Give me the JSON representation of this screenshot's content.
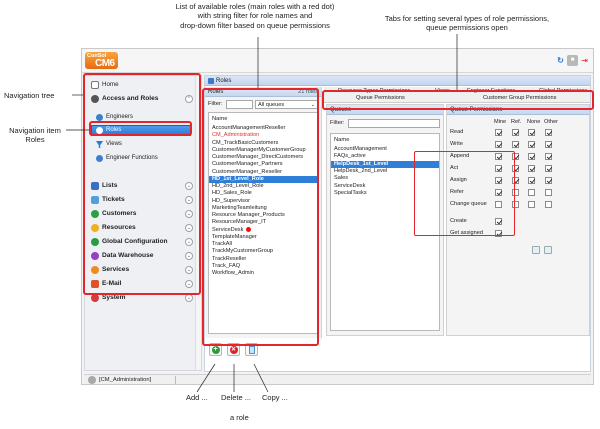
{
  "annotations": {
    "roles_list": [
      "List of available roles (main roles with a red dot)",
      "with string filter for role names and",
      "drop-down filter based on queue permissions"
    ],
    "tabs": [
      "Tabs for setting several types of role permissions,",
      "queue permissions open"
    ],
    "nav_tree": "Navigation tree",
    "nav_item": [
      "Navigation item",
      "Roles"
    ],
    "add": "Add ...",
    "delete": "Delete ...",
    "copy": "Copy ...",
    "a_role": "a role"
  },
  "app": {
    "logo_top": "ConSol",
    "logo_main": "CM6"
  },
  "sidebar": {
    "home": "Home",
    "access_and_roles": "Access and Roles",
    "sub_items": [
      "Engineers",
      "Roles",
      "Views",
      "Engineer Functions"
    ],
    "groups": [
      "Lists",
      "Tickets",
      "Customers",
      "Resources",
      "Global Configuration",
      "Data Warehouse",
      "Services",
      "E-Mail",
      "System"
    ]
  },
  "status": {
    "user": "[CM_Administration]"
  },
  "main": {
    "title": "Roles"
  },
  "roles_panel": {
    "title": "Roles",
    "count": "21 roles",
    "filter_label": "Filter:",
    "dropdown_value": "All queues",
    "list_header": "Name",
    "items": [
      {
        "name": "AccountManagementReseller",
        "style": ""
      },
      {
        "name": "CM_Administration",
        "style": "red"
      },
      {
        "name": "CM_TrackBasicCustomers",
        "style": ""
      },
      {
        "name": "CustomerManagerMyCustomerGroup",
        "style": ""
      },
      {
        "name": "CustomerManager_DirectCustomers",
        "style": ""
      },
      {
        "name": "CustomerManager_Partners",
        "style": ""
      },
      {
        "name": "CustomerManager_Reseller",
        "style": ""
      },
      {
        "name": "HD_1st_Level_Role",
        "style": "sel"
      },
      {
        "name": "HD_2nd_Level_Role",
        "style": ""
      },
      {
        "name": "HD_Sales_Role",
        "style": ""
      },
      {
        "name": "HD_Supervisor",
        "style": ""
      },
      {
        "name": "MarketingTeamleitung",
        "style": ""
      },
      {
        "name": "Resource Manager_Products",
        "style": ""
      },
      {
        "name": "ResourceManager_IT",
        "style": ""
      },
      {
        "name": "ServiceDesk",
        "style": "dot"
      },
      {
        "name": "TemplateManager",
        "style": ""
      },
      {
        "name": "TrackAll",
        "style": ""
      },
      {
        "name": "TrackMyCustomerGroup",
        "style": ""
      },
      {
        "name": "TrackReseller",
        "style": ""
      },
      {
        "name": "Track_FAQ",
        "style": ""
      },
      {
        "name": "Workflow_Admin",
        "style": ""
      }
    ]
  },
  "tabs": {
    "row1": [
      "Resource Types Permissions",
      "Views",
      "Engineer Functions",
      "Global Permissions"
    ],
    "row2": [
      "Queue Permissions",
      "Customer Group Permissions"
    ]
  },
  "queues_panel": {
    "title": "Queues",
    "filter_label": "Filter:",
    "list_header": "Name",
    "items": [
      {
        "name": "AccountManagement",
        "style": ""
      },
      {
        "name": "FAQs_active",
        "style": ""
      },
      {
        "name": "HelpDesk_1st_Level",
        "style": "sel"
      },
      {
        "name": "HelpDesk_2nd_Level",
        "style": ""
      },
      {
        "name": "Sales",
        "style": ""
      },
      {
        "name": "ServiceDesk",
        "style": ""
      },
      {
        "name": "SpecialTasks",
        "style": ""
      }
    ]
  },
  "queue_permissions": {
    "title": "Queue Permissions",
    "columns": [
      "Mine",
      "Ref.",
      "None",
      "Other"
    ],
    "rows": [
      {
        "label": "Read",
        "checks": [
          true,
          true,
          true,
          true
        ]
      },
      {
        "label": "Write",
        "checks": [
          true,
          true,
          true,
          true
        ]
      },
      {
        "label": "Append",
        "checks": [
          true,
          true,
          true,
          true
        ]
      },
      {
        "label": "Act",
        "checks": [
          true,
          true,
          true,
          true
        ]
      },
      {
        "label": "Assign",
        "checks": [
          true,
          true,
          true,
          true
        ]
      },
      {
        "label": "Refer",
        "checks": [
          true,
          false,
          false,
          false
        ]
      },
      {
        "label": "Change queue",
        "checks": [
          false,
          false,
          false,
          false
        ]
      }
    ],
    "single_rows": [
      {
        "label": "Create",
        "checked": true
      },
      {
        "label": "Get assigned",
        "checked": true
      }
    ]
  }
}
